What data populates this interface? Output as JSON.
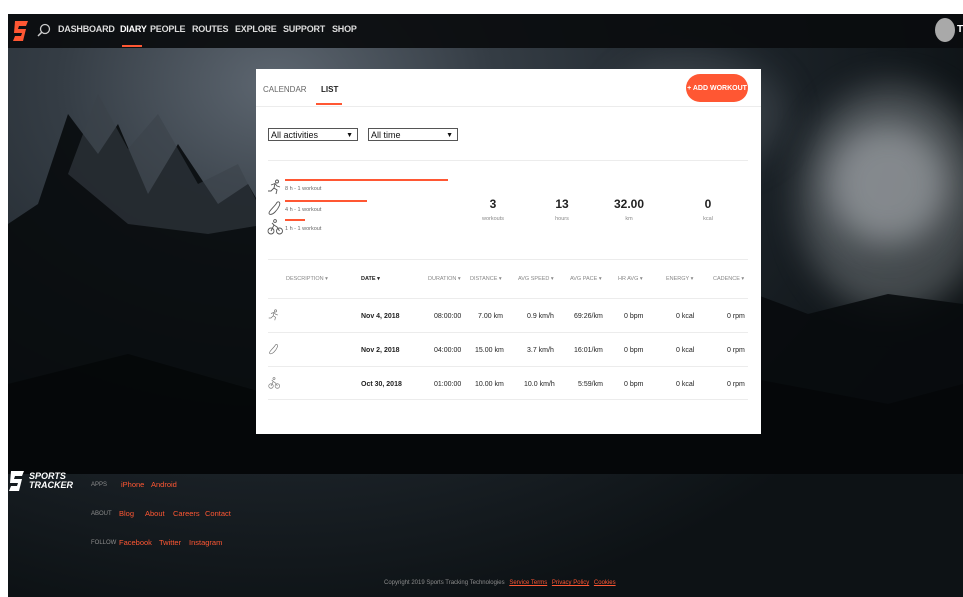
{
  "nav": {
    "items": [
      "DASHBOARD",
      "DIARY",
      "PEOPLE",
      "ROUTES",
      "EXPLORE",
      "SUPPORT",
      "SHOP"
    ],
    "active": "DIARY",
    "user_initial": "T"
  },
  "diary": {
    "tabs": [
      "CALENDAR",
      "LIST"
    ],
    "active_tab": "LIST",
    "add_button": "+ ADD WORKOUT",
    "filters": {
      "activity": "All activities",
      "period": "All time"
    },
    "activity_summary": [
      {
        "icon": "running-icon",
        "label": "8 h - 1 workout",
        "share": 1.0
      },
      {
        "icon": "walking-icon",
        "label": "4 h - 1 workout",
        "share": 0.5
      },
      {
        "icon": "cycling-icon",
        "label": "1 h - 1 workout",
        "share": 0.125
      }
    ],
    "totals": [
      {
        "value": "3",
        "unit": "workouts"
      },
      {
        "value": "13",
        "unit": "hours"
      },
      {
        "value": "32.00",
        "unit": "km"
      },
      {
        "value": "0",
        "unit": "kcal"
      }
    ],
    "table": {
      "headers": [
        "DESCRIPTION ▾",
        "DATE ▾",
        "DURATION ▾",
        "DISTANCE ▾",
        "AVG SPEED ▾",
        "AVG PACE ▾",
        "HR AVG ▾",
        "ENERGY ▾",
        "CADENCE ▾"
      ],
      "rows": [
        {
          "icon": "running-icon",
          "date": "Nov 4, 2018",
          "duration": "08:00:00",
          "distance": "7.00 km",
          "avg_speed": "0.9 km/h",
          "avg_pace": "69:26/km",
          "hr_avg": "0 bpm",
          "energy": "0 kcal",
          "cadence": "0 rpm"
        },
        {
          "icon": "walking-icon",
          "date": "Nov 2, 2018",
          "duration": "04:00:00",
          "distance": "15.00 km",
          "avg_speed": "3.7 km/h",
          "avg_pace": "16:01/km",
          "hr_avg": "0 bpm",
          "energy": "0 kcal",
          "cadence": "0 rpm"
        },
        {
          "icon": "cycling-icon",
          "date": "Oct 30, 2018",
          "duration": "01:00:00",
          "distance": "10.00 km",
          "avg_speed": "10.0 km/h",
          "avg_pace": "5:59/km",
          "hr_avg": "0 bpm",
          "energy": "0 kcal",
          "cadence": "0 rpm"
        }
      ]
    }
  },
  "footer": {
    "logo_text": [
      "SPORTS",
      "TRACKER"
    ],
    "apps_label": "APPS",
    "apps_links": [
      "iPhone",
      "Android"
    ],
    "about_label": "ABOUT",
    "about_links": [
      "Blog",
      "About",
      "Careers",
      "Contact"
    ],
    "follow_label": "FOLLOW",
    "follow_links": [
      "Facebook",
      "Twitter",
      "Instagram"
    ],
    "copyright": "Copyright 2019 Sports Tracking Technologies",
    "legal_links": [
      "Service Terms",
      "Privacy Policy",
      "Cookies"
    ]
  },
  "colors": {
    "accent": "#ff5733",
    "nav_bg": "#0a0c0e",
    "panel_bg": "#ffffff"
  }
}
